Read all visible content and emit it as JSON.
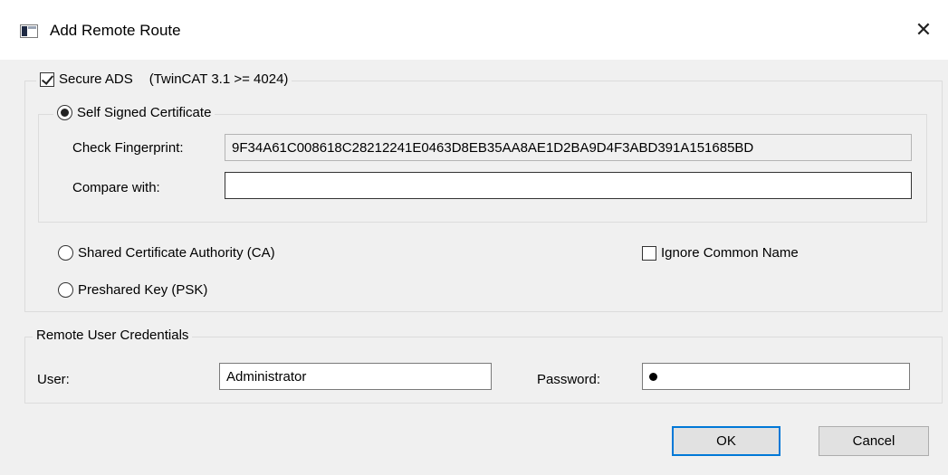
{
  "window": {
    "title": "Add Remote Route",
    "close_glyph": "✕",
    "icon": "window-app-icon"
  },
  "secure_ads": {
    "label": "Secure ADS",
    "note": "(TwinCAT 3.1 >= 4024)",
    "checked": true,
    "self_signed": {
      "label": "Self Signed Certificate",
      "selected": true,
      "fingerprint_label": "Check Fingerprint:",
      "fingerprint_value": "9F34A61C008618C28212241E0463D8EB35AA8AE1D2BA9D4F3ABD391A151685BD",
      "compare_label": "Compare with:",
      "compare_value": ""
    },
    "shared_ca": {
      "label": "Shared Certificate Authority (CA)",
      "selected": false
    },
    "ignore_common_name": {
      "label": "Ignore Common Name",
      "checked": false
    },
    "psk": {
      "label": "Preshared Key (PSK)",
      "selected": false
    }
  },
  "credentials": {
    "title": "Remote User Credentials",
    "user_label": "User:",
    "user_value": "Administrator",
    "password_label": "Password:",
    "password_mask": "●"
  },
  "buttons": {
    "ok": "OK",
    "cancel": "Cancel"
  }
}
